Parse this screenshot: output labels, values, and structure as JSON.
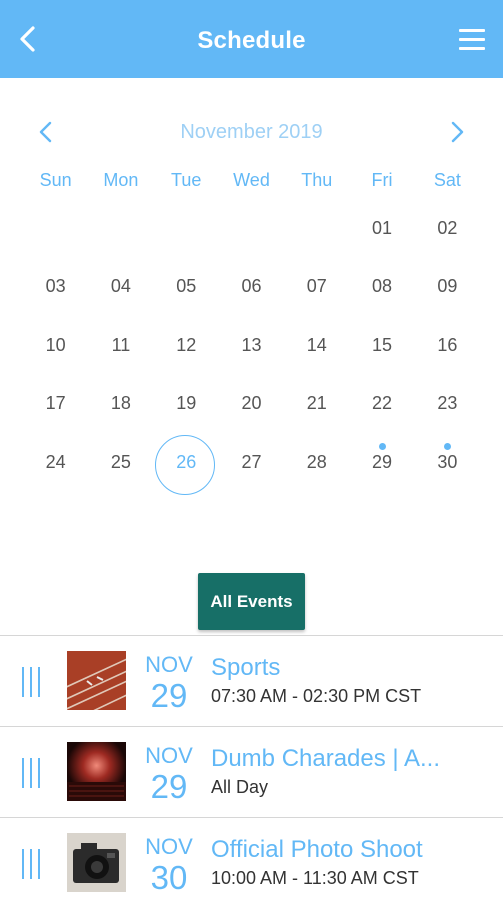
{
  "header": {
    "title": "Schedule",
    "back_icon": "chevron-left-icon",
    "menu_icon": "hamburger-menu-icon"
  },
  "calendar": {
    "month_label": "November 2019",
    "weekdays": [
      "Sun",
      "Mon",
      "Tue",
      "Wed",
      "Thu",
      "Fri",
      "Sat"
    ],
    "weeks": [
      [
        "",
        "",
        "",
        "",
        "",
        "01",
        "02"
      ],
      [
        "03",
        "04",
        "05",
        "06",
        "07",
        "08",
        "09"
      ],
      [
        "10",
        "11",
        "12",
        "13",
        "14",
        "15",
        "16"
      ],
      [
        "17",
        "18",
        "19",
        "20",
        "21",
        "22",
        "23"
      ],
      [
        "24",
        "25",
        "26",
        "27",
        "28",
        "29",
        "30"
      ]
    ],
    "selected_day": "26",
    "event_days": [
      "29",
      "30"
    ]
  },
  "all_events_label": "All Events",
  "events": [
    {
      "month": "NOV",
      "day": "29",
      "name": "Sports",
      "time": "07:30 AM - 02:30 PM CST",
      "thumb": "running-track-image"
    },
    {
      "month": "NOV",
      "day": "29",
      "name": "Dumb Charades | A...",
      "time": "All Day",
      "thumb": "theater-stage-image"
    },
    {
      "month": "NOV",
      "day": "30",
      "name": "Official Photo Shoot",
      "time": "10:00 AM - 11:30 AM CST",
      "thumb": "camera-image"
    }
  ],
  "colors": {
    "accent": "#62b8f6",
    "button": "#176f67",
    "month_label": "#9ed0f5"
  }
}
